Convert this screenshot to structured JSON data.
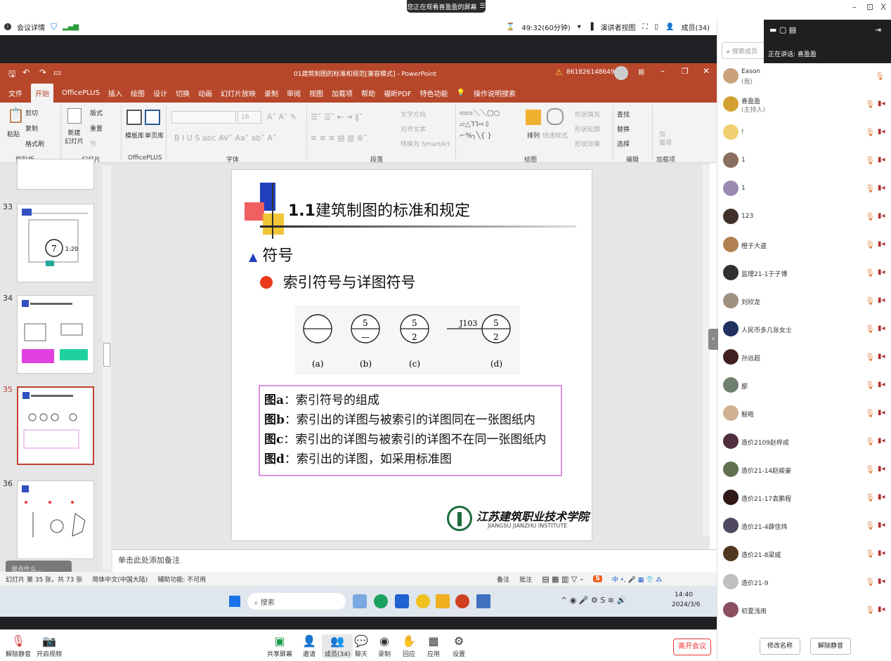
{
  "banner": "您正在观看喜盈盈的屏幕",
  "window_controls": [
    "–",
    "⊡",
    "X"
  ],
  "meeting": {
    "details": "会议详情",
    "timer": "49:32(60分钟)",
    "presenter_view": "演讲者视图",
    "members_tab": "成员(34)"
  },
  "ppt": {
    "title": "01建筑制图的标准和规范[兼容模式] - PowerPoint",
    "meeting_id": "8618261486492",
    "tabs": [
      "文件",
      "开始",
      "OfficePLUS",
      "插入",
      "绘图",
      "设计",
      "切换",
      "动画",
      "幻灯片放映",
      "录制",
      "审阅",
      "视图",
      "加载项",
      "帮助",
      "福昕PDF",
      "特色功能",
      "操作说明搜索"
    ],
    "active_tab": "开始",
    "ribbon": {
      "paste": "粘贴",
      "cut": "剪切",
      "copy": "复制",
      "format_painter": "格式刷",
      "new_slide": "新建\n幻灯片",
      "layout": "版式",
      "reset": "重置",
      "section": "节",
      "template": "模板库",
      "single": "单页库",
      "font_size": "16",
      "text_direction": "文字方向",
      "align_text": "对齐文本",
      "smartart": "转换为 SmartArt",
      "arrange": "排列",
      "quick_styles": "快速样式",
      "shape_fill": "形状填充",
      "shape_outline": "形状轮廓",
      "shape_effects": "形状效果",
      "find": "查找",
      "replace": "替换",
      "select": "选择",
      "addin": "加\n载项",
      "groups": [
        "剪贴板",
        "幻灯片",
        "OfficePLUS",
        "字体",
        "段落",
        "绘图",
        "编辑",
        "加载项"
      ]
    },
    "thumbs": [
      {
        "num": "33"
      },
      {
        "num": "34"
      },
      {
        "num": "35"
      },
      {
        "num": "36"
      }
    ],
    "notes_placeholder": "单击此处添加备注",
    "status": {
      "slide": "幻灯片 第 35 张，共 73 张",
      "lang": "简体中文(中国大陆)",
      "access": "辅助功能: 不可用",
      "notes": "备注",
      "comments": "批注"
    }
  },
  "slide": {
    "title_num": "1.1",
    "title_text": "建筑制图的标准和规定",
    "section": "符号",
    "subsection": "索引符号与详图符号",
    "fig_labels": [
      "(a)",
      "(b)",
      "(c)",
      "(d)"
    ],
    "fig_b": {
      "top": "5",
      "bottom": "—"
    },
    "fig_c": {
      "top": "5",
      "bottom": "2"
    },
    "fig_d": {
      "ref": "J103",
      "top": "5",
      "bottom": "2"
    },
    "captions": [
      {
        "k": "图a",
        "v": "：索引符号的组成"
      },
      {
        "k": "图b",
        "v": "：索引出的详图与被索引的详图同在一张图纸内"
      },
      {
        "k": "图c",
        "v": "：索引出的详图与被索引的详图不在同一张图纸内"
      },
      {
        "k": "图d",
        "v": "：索引出的详图，如采用标准图"
      }
    ],
    "logo_cn": "江苏建筑职业技术学院",
    "logo_en": "JIANGSU JIANZHU INSTITUTE"
  },
  "taskbar": {
    "search": "搜索",
    "time": "14:40",
    "date": "2024/3/6"
  },
  "meet_bar": {
    "mute": "解除静音",
    "video": "开启视频",
    "share": "共享屏幕",
    "invite": "邀请",
    "members": "成员(34)",
    "chat": "聊天",
    "record": "录制",
    "react": "回应",
    "apps": "应用",
    "settings": "设置",
    "leave": "离开会议",
    "chat_hint": "说点什么..."
  },
  "members_panel": {
    "search_placeholder": "搜索成员",
    "speaking": "正在讲话: 喜盈盈",
    "list": [
      {
        "name": "Eason",
        "sub": "(我)",
        "color": "#c9a27a"
      },
      {
        "name": "喜盈盈",
        "sub": "(主持人)",
        "color": "#d4a032"
      },
      {
        "name": "!",
        "sub": "",
        "color": "#f0d070"
      },
      {
        "name": "1",
        "sub": "",
        "color": "#8a7060"
      },
      {
        "name": "1",
        "sub": "",
        "color": "#9a8ab0"
      },
      {
        "name": "123",
        "sub": "",
        "color": "#403028"
      },
      {
        "name": "橙子大盗",
        "sub": "",
        "color": "#b08050"
      },
      {
        "name": "监理21-1于子博",
        "sub": "",
        "color": "#303030"
      },
      {
        "name": "刘欣龙",
        "sub": "",
        "color": "#a09080"
      },
      {
        "name": "人民币多几张女士",
        "sub": "",
        "color": "#203060"
      },
      {
        "name": "孙远超",
        "sub": "",
        "color": "#402020"
      },
      {
        "name": "鄙",
        "sub": "",
        "color": "#708070"
      },
      {
        "name": "殷皓",
        "sub": "",
        "color": "#d0b090"
      },
      {
        "name": "造价2109赵梓成",
        "sub": "",
        "color": "#503040"
      },
      {
        "name": "造价21-14赵峻豪",
        "sub": "",
        "color": "#607050"
      },
      {
        "name": "造价21-17袁鹏程",
        "sub": "",
        "color": "#301818"
      },
      {
        "name": "造价21-4薛佳炜",
        "sub": "",
        "color": "#504860"
      },
      {
        "name": "造价21-8梁威",
        "sub": "",
        "color": "#503820"
      },
      {
        "name": "造价21-9",
        "sub": "",
        "color": "#c0c0c0"
      },
      {
        "name": "初夏浅雨",
        "sub": "",
        "color": "#8a5060"
      }
    ],
    "rename": "修改名称",
    "unmute_all": "解除静音"
  },
  "colors": {
    "ppt_red": "#b7472a",
    "slide_blue": "#1f3fbf",
    "caption_border": "#e090e0",
    "selected_thumb": "#c04030"
  }
}
